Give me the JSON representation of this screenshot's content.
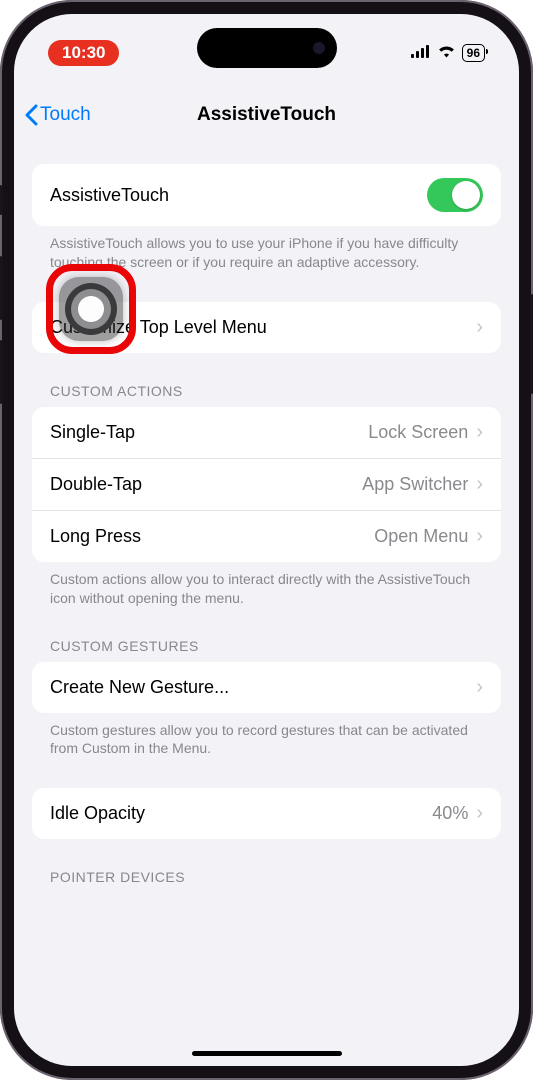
{
  "status": {
    "time": "10:30",
    "battery": "96"
  },
  "nav": {
    "back": "Touch",
    "title": "AssistiveTouch"
  },
  "main_toggle": {
    "label": "AssistiveTouch",
    "enabled": true,
    "description": "AssistiveTouch allows you to use your iPhone if you have difficulty touching the screen or if you require an adaptive accessory."
  },
  "customize": {
    "label": "Customize Top Level Menu"
  },
  "custom_actions": {
    "header": "CUSTOM ACTIONS",
    "rows": [
      {
        "label": "Single-Tap",
        "value": "Lock Screen"
      },
      {
        "label": "Double-Tap",
        "value": "App Switcher"
      },
      {
        "label": "Long Press",
        "value": "Open Menu"
      }
    ],
    "footer": "Custom actions allow you to interact directly with the AssistiveTouch icon without opening the menu."
  },
  "custom_gestures": {
    "header": "CUSTOM GESTURES",
    "create_label": "Create New Gesture...",
    "footer": "Custom gestures allow you to record gestures that can be activated from Custom in the Menu."
  },
  "idle_opacity": {
    "label": "Idle Opacity",
    "value": "40%"
  },
  "pointer_devices": {
    "header": "POINTER DEVICES"
  }
}
